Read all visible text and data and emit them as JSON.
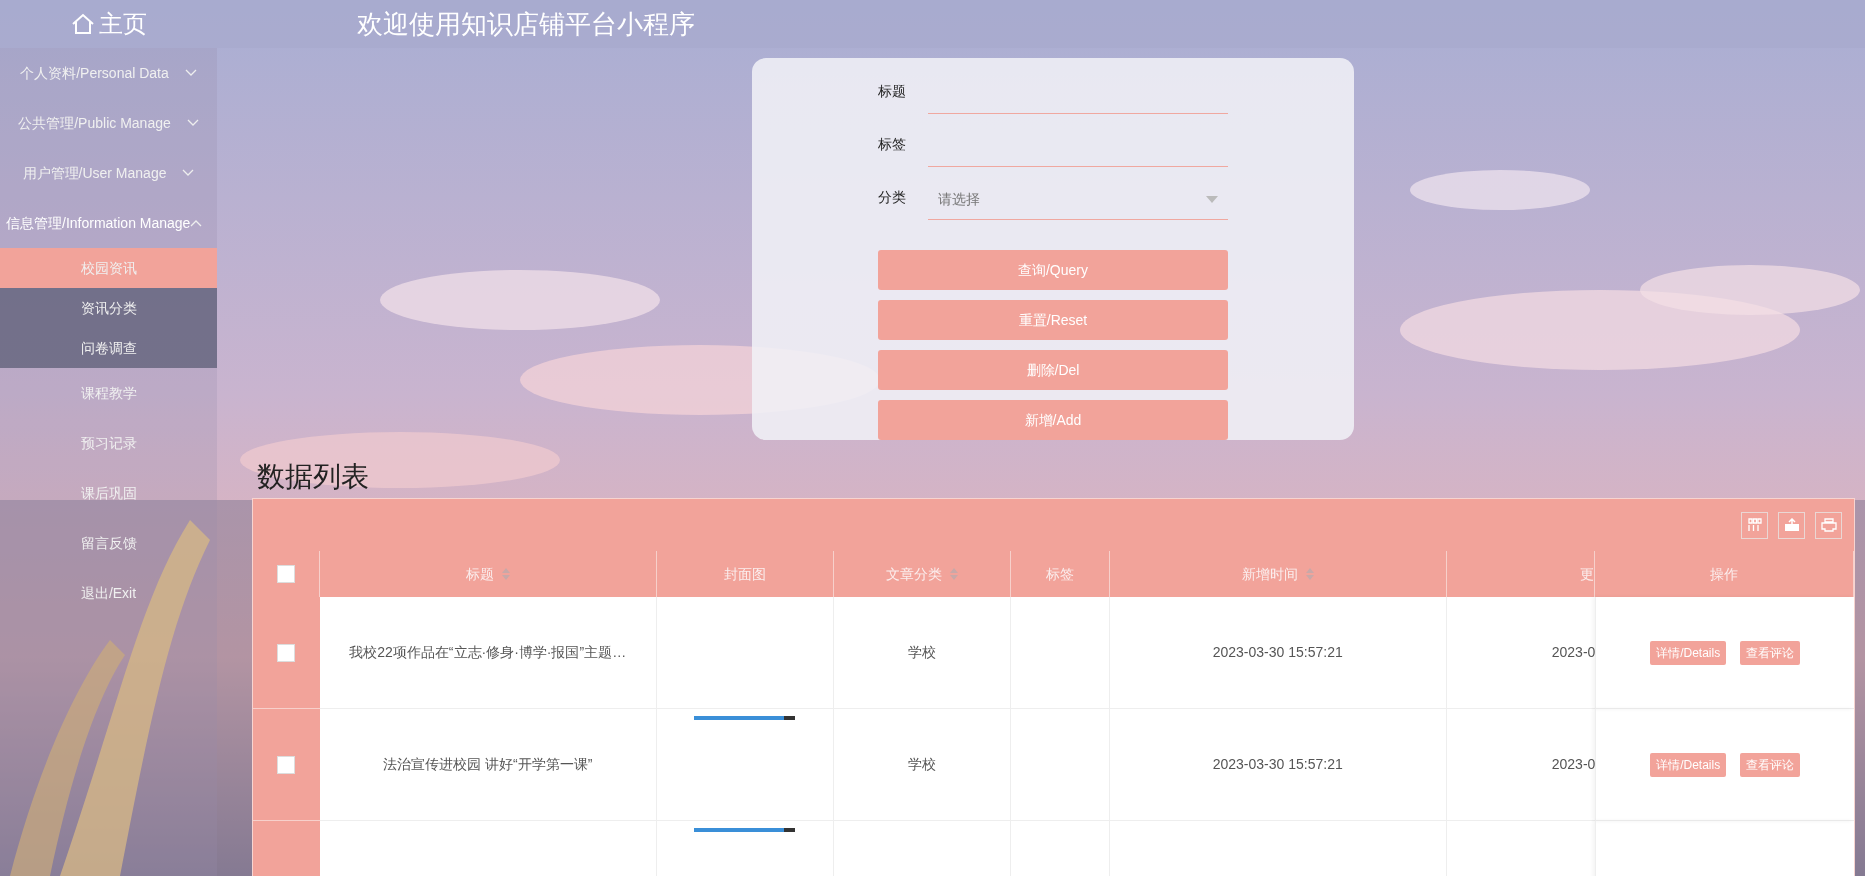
{
  "header": {
    "home": "主页",
    "title": "欢迎使用知识店铺平台小程序"
  },
  "sidebar": {
    "items": [
      {
        "label": "个人资料/Personal Data",
        "expanded": false
      },
      {
        "label": "公共管理/Public Manage",
        "expanded": false
      },
      {
        "label": "用户管理/User Manage",
        "expanded": false
      },
      {
        "label": "信息管理/Information Manage",
        "expanded": true,
        "children": [
          {
            "label": "校园资讯",
            "selected": true
          },
          {
            "label": "资讯分类",
            "selected": false
          },
          {
            "label": "问卷调查",
            "selected": false
          }
        ]
      },
      {
        "label": "课程教学"
      },
      {
        "label": "预习记录"
      },
      {
        "label": "课后巩固"
      },
      {
        "label": "留言反馈"
      },
      {
        "label": "退出/Exit"
      }
    ]
  },
  "search": {
    "fields": [
      {
        "label": "标题",
        "kind": "text"
      },
      {
        "label": "标签",
        "kind": "text"
      },
      {
        "label": "分类",
        "kind": "select",
        "placeholder": "请选择"
      }
    ],
    "buttons": [
      "查询/Query",
      "重置/Reset",
      "删除/Del",
      "新增/Add"
    ]
  },
  "list_title": "数据列表",
  "table": {
    "select_all_checked": false,
    "columns": [
      {
        "label": "标题",
        "sortable": true
      },
      {
        "label": "封面图",
        "sortable": false
      },
      {
        "label": "文章分类",
        "sortable": true
      },
      {
        "label": "标签",
        "sortable": false
      },
      {
        "label": "新增时间",
        "sortable": true
      },
      {
        "label": "更",
        "sortable": false
      },
      {
        "label": "操作",
        "sortable": false
      }
    ],
    "rows": [
      {
        "kind": "full",
        "checked": false,
        "title": "我校22项作品在“立志·修身·博学·报国”主题…",
        "cover": false,
        "category": "学校",
        "created": "2023-03-30 15:57:21",
        "updated": "2023-0",
        "actions": [
          "详情/Details",
          "查看评论"
        ]
      },
      {
        "kind": "full",
        "checked": false,
        "title": "法治宣传进校园 讲好“开学第一课”",
        "cover": true,
        "category": "学校",
        "created": "2023-03-30 15:57:21",
        "updated": "2023-0",
        "actions": [
          "详情/Details",
          "查看评论"
        ]
      },
      {
        "kind": "partial",
        "cover": true
      }
    ]
  }
}
